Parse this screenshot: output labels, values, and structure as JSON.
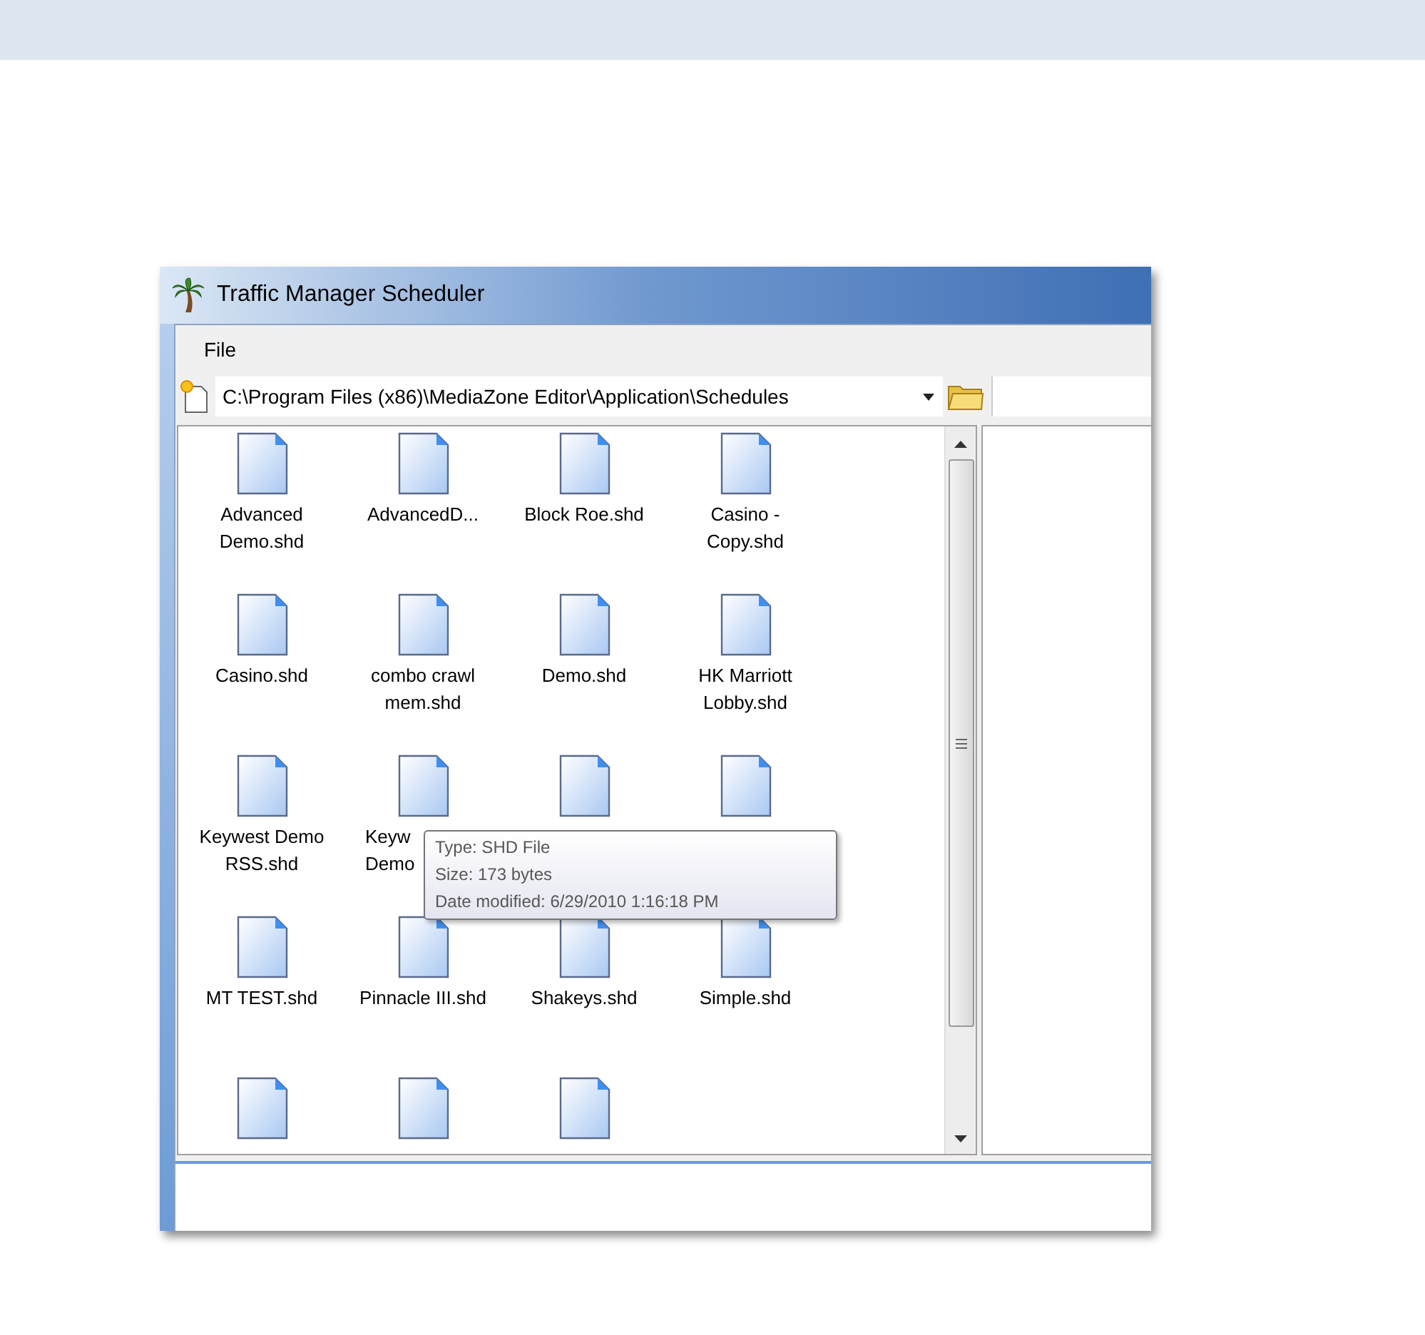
{
  "window": {
    "title": "Traffic Manager Scheduler"
  },
  "menu": [
    {
      "label": "File"
    }
  ],
  "path": {
    "value": "C:\\Program Files (x86)\\MediaZone Editor\\Application\\Schedules"
  },
  "files": [
    {
      "kind": "file",
      "label": "Advanced Demo.shd"
    },
    {
      "kind": "file",
      "label": "AdvancedD..."
    },
    {
      "kind": "file",
      "label": "Block Roe.shd"
    },
    {
      "kind": "file",
      "label": "Casino - Copy.shd"
    },
    {
      "kind": "file",
      "label": "Casino.shd"
    },
    {
      "kind": "file",
      "label": "combo crawl mem.shd"
    },
    {
      "kind": "file",
      "label": "Demo.shd"
    },
    {
      "kind": "file",
      "label": "HK Marriott Lobby.shd"
    },
    {
      "kind": "file",
      "label": "Keywest Demo RSS.shd"
    },
    {
      "kind": "partial",
      "label": "Keyw Demo"
    },
    {
      "kind": "icon"
    },
    {
      "kind": "icon"
    },
    {
      "kind": "file",
      "label": "MT TEST.shd"
    },
    {
      "kind": "file",
      "label": "Pinnacle III.shd"
    },
    {
      "kind": "file",
      "label": "Shakeys.shd"
    },
    {
      "kind": "file",
      "label": "Simple.shd"
    },
    {
      "kind": "icon"
    },
    {
      "kind": "icon"
    },
    {
      "kind": "icon"
    }
  ],
  "tooltip": {
    "lines": [
      "Type: SHD File",
      "Size: 173 bytes",
      "Date modified: 6/29/2010 1:16:18 PM"
    ]
  }
}
